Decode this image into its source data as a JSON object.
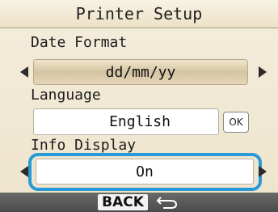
{
  "title": "Printer Setup",
  "sections": {
    "date_format": {
      "label": "Date Format",
      "value": "dd/mm/yy"
    },
    "language": {
      "label": "Language",
      "value": "English",
      "ok_label": "OK"
    },
    "info_display": {
      "label": "Info Display",
      "value": "On"
    }
  },
  "footer": {
    "back_label": "BACK",
    "back_icon": "return-arrow-icon"
  },
  "colors": {
    "highlight": "#2a9ad6",
    "bottom_bar": "#555555",
    "background": "#f2ead6"
  }
}
